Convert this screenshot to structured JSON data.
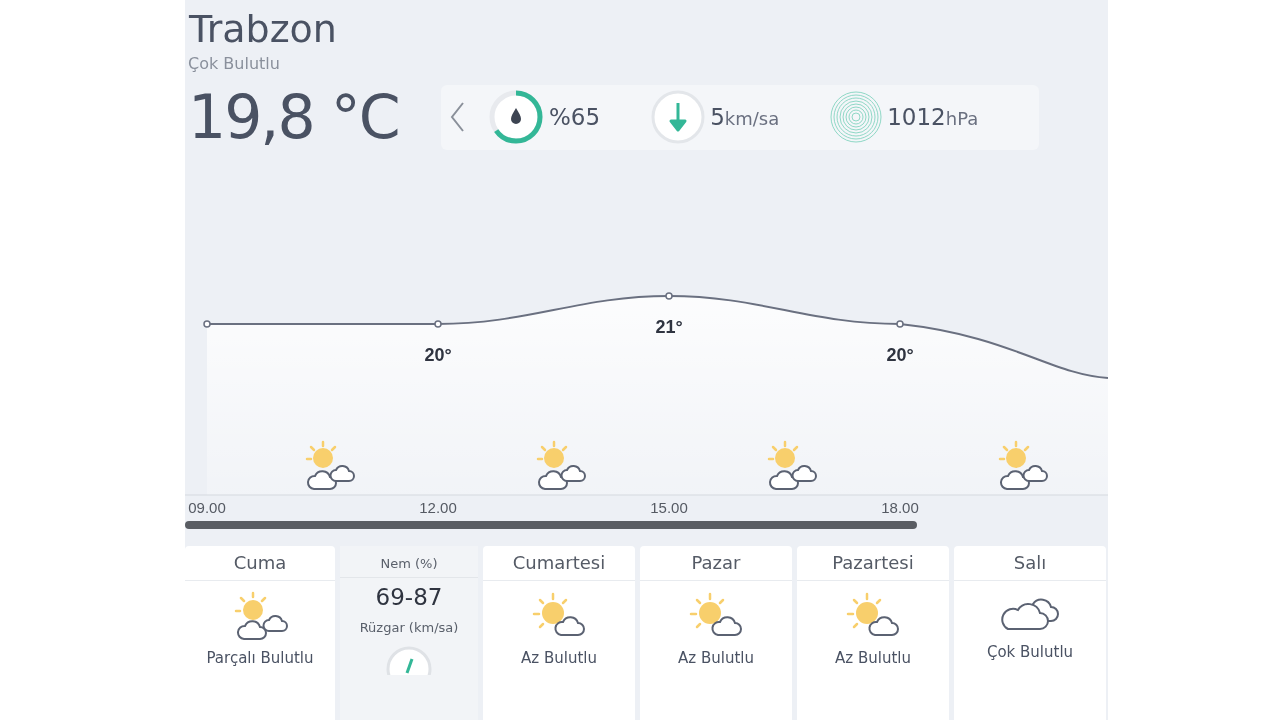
{
  "city": "Trabzon",
  "condition": "Çok Bulutlu",
  "temperature": "19,8 °C",
  "stats": [
    {
      "kind": "humidity",
      "value": "%65",
      "level": 0.65
    },
    {
      "kind": "wind",
      "value": "5",
      "unit": "km/sa"
    },
    {
      "kind": "pressure",
      "value": "1012",
      "unit": "hPa"
    }
  ],
  "hourly": {
    "chart_data": {
      "type": "line",
      "categories": [
        "09.00",
        "12.00",
        "15.00",
        "18.00"
      ],
      "values": [
        20,
        20,
        21,
        20
      ],
      "marker": true,
      "value_labels": [
        null,
        "20°",
        "21°",
        "20°"
      ]
    },
    "icons": [
      {
        "kind": "partly"
      },
      {
        "kind": "partly"
      },
      {
        "kind": "partly"
      },
      {
        "kind": "partly"
      }
    ]
  },
  "days": [
    {
      "day": "Cuma",
      "condition": "Parçalı Bulutlu",
      "kind": "partly"
    },
    {
      "kind": "details",
      "humidity_label": "Nem (%)",
      "humidity": "69-87",
      "wind_label": "Rüzgar (km/sa)"
    },
    {
      "day": "Cumartesi",
      "condition": "Az Bulutlu",
      "kind": "few"
    },
    {
      "day": "Pazar",
      "condition": "Az Bulutlu",
      "kind": "few"
    },
    {
      "day": "Pazartesi",
      "condition": "Az Bulutlu",
      "kind": "few"
    },
    {
      "day": "Salı",
      "condition": "Çok Bulutlu",
      "kind": "overcast"
    }
  ]
}
